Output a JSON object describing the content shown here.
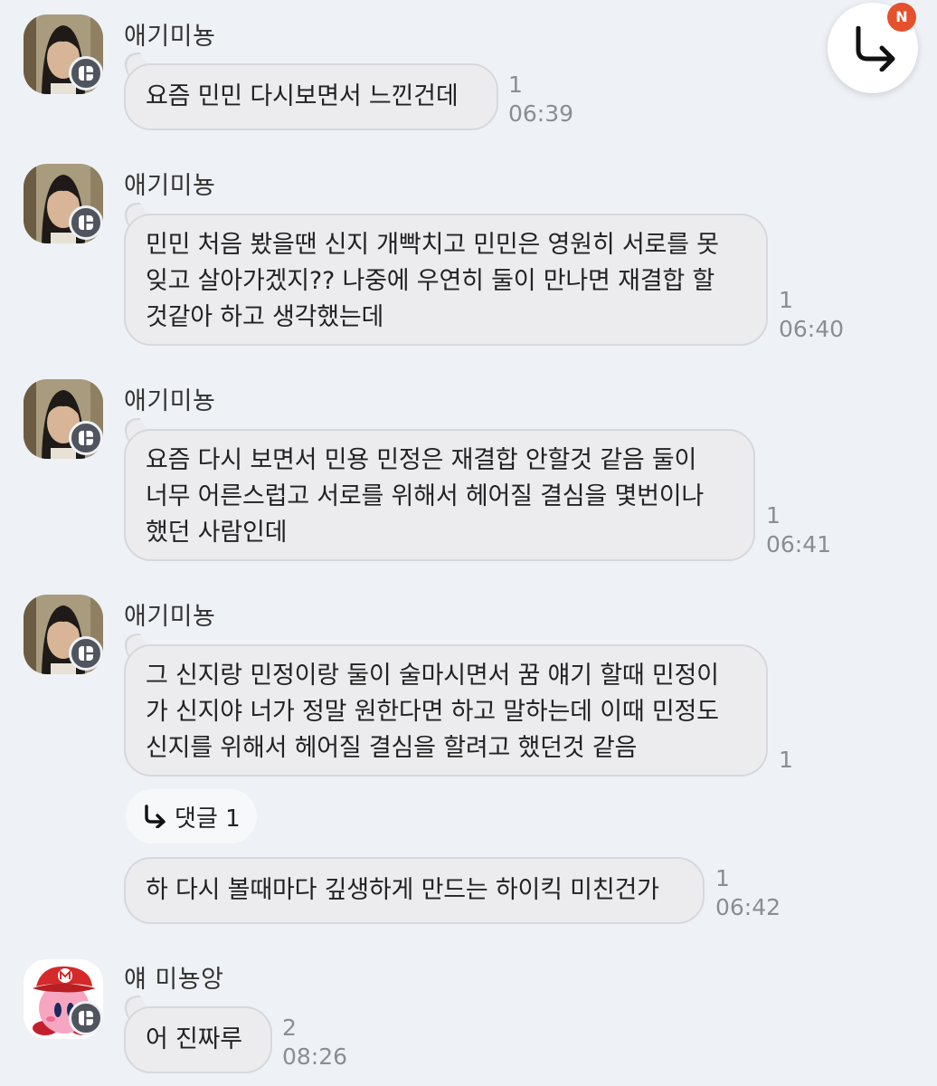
{
  "messages": [
    {
      "sender": "애기미뇽",
      "lines": [
        "요즘 민민 다시보면서 느낀건데"
      ],
      "unread": "1",
      "time": "06:39"
    },
    {
      "sender": "애기미뇽",
      "lines": [
        "민민 처음 봤을땐 신지 개빡치고 민민은 영원히 서로를 못",
        "잊고 살아가겠지?? 나중에 우연히 둘이 만나면 재결합 할",
        "것같아 하고 생각했는데"
      ],
      "unread": "1",
      "time": "06:40"
    },
    {
      "sender": "애기미뇽",
      "lines": [
        "요즘 다시 보면서 민용 민정은 재결합 안할것 같음 둘이",
        "너무 어른스럽고 서로를 위해서 헤어질 결심을 몇번이나",
        "했던 사람인데"
      ],
      "unread": "1",
      "time": "06:41"
    },
    {
      "sender": "애기미뇽",
      "lines": [
        "그 신지랑 민정이랑 둘이 술마시면서 꿈 얘기 할때 민정이",
        "가 신지야 너가 정말 원한다면 하고 말하는데 이때 민정도",
        "신지를 위해서 헤어질 결심을 할려고 했던것 같음"
      ],
      "unread": "1",
      "reply_label": "댓글 1"
    },
    {
      "lines": [
        "하 다시 볼때마다 깊생하게 만드는 하이킥 미친건가"
      ],
      "unread": "1",
      "time": "06:42"
    },
    {
      "sender": "얘 미뇽앙",
      "lines": [
        "어 진짜루"
      ],
      "unread": "2",
      "time": "08:26"
    }
  ],
  "fab": {
    "icon": "reply-arrow-icon",
    "badge": "N"
  },
  "colors": {
    "background": "#eef1f6",
    "bubble": "#ececef",
    "badge": "#e5512c"
  }
}
